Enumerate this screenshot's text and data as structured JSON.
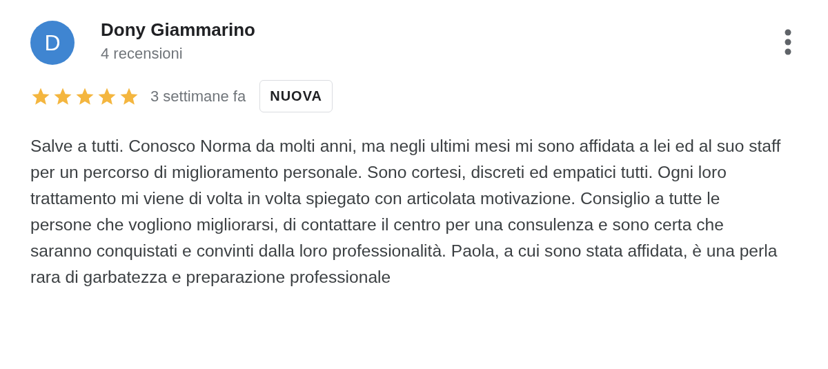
{
  "review": {
    "author": {
      "initial": "D",
      "name": "Dony Giammarino",
      "reviews": "4 recensioni"
    },
    "stars": 5,
    "time": "3 settimane fa",
    "badge": "NUOVA",
    "text": "Salve a tutti. Conosco Norma da molti anni, ma negli ultimi mesi mi sono affidata a lei ed al suo staff per un percorso di miglioramento personale. Sono cortesi, discreti ed empatici tutti. Ogni loro trattamento mi viene di volta in volta spiegato con articolata motivazione. Consiglio a tutte le persone che vogliono migliorarsi, di contattare il centro per una consulenza e sono certa che saranno conquistati e convinti dalla loro professionalità. Paola, a cui sono stata affidata, è una perla rara di garbatezza e preparazione professionale"
  }
}
